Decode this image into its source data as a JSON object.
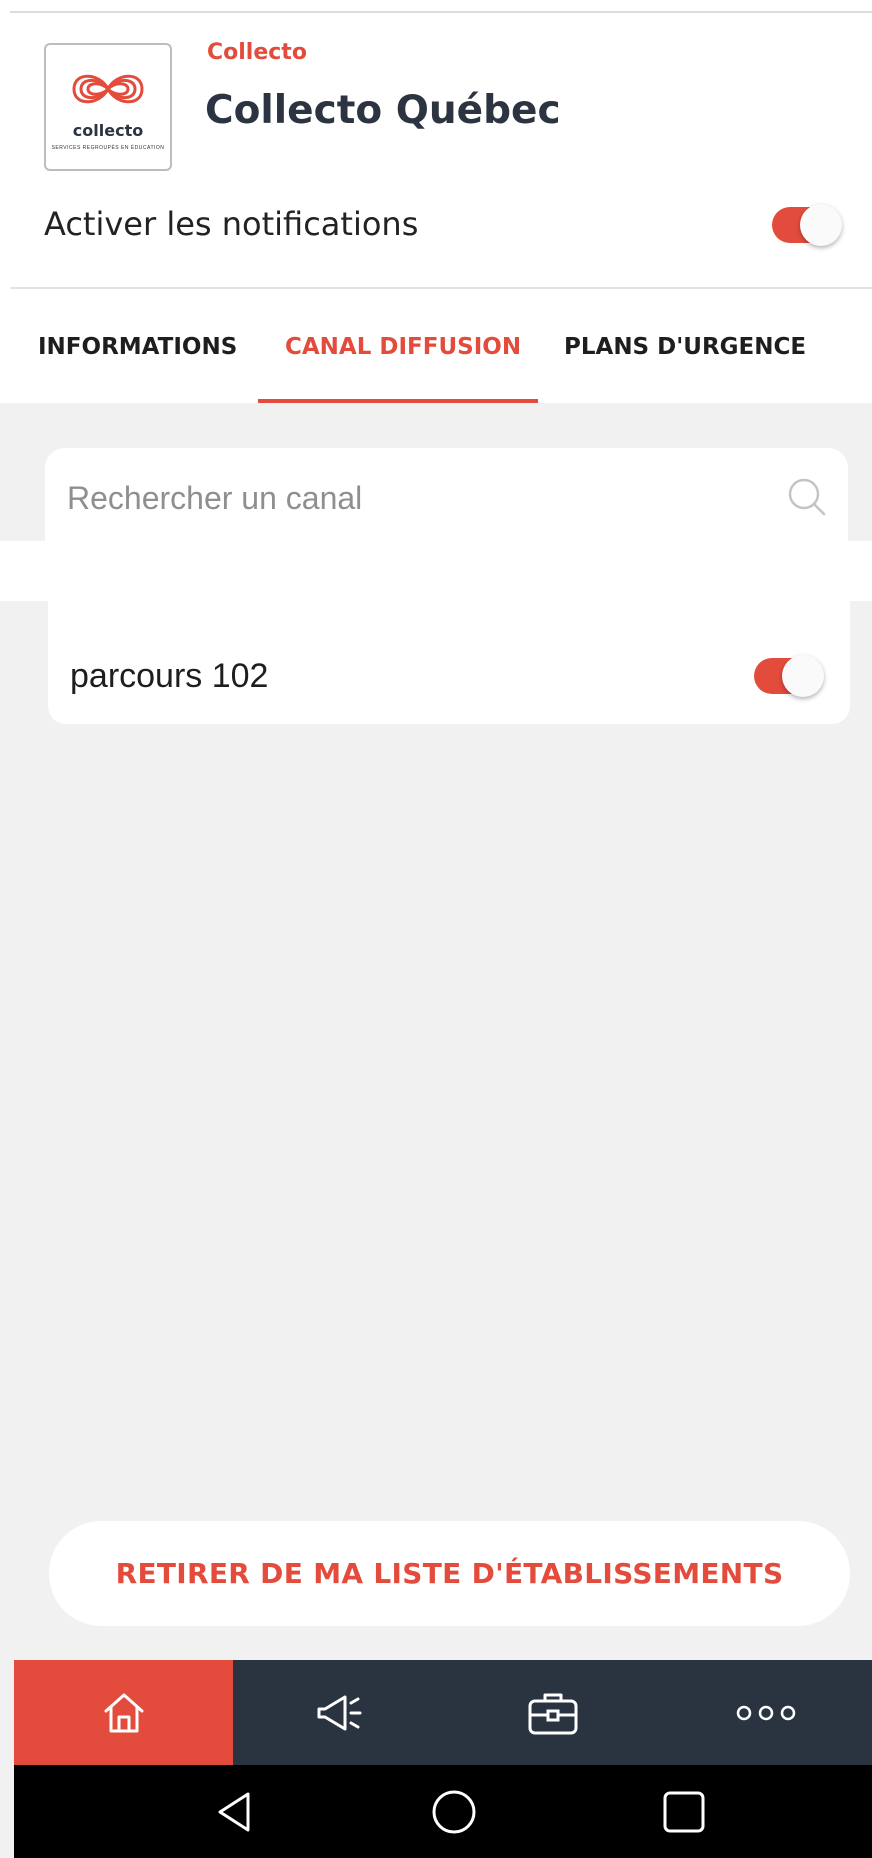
{
  "header": {
    "logo_word": "collecto",
    "logo_tagline": "SERVICES REGROUPÉS EN ÉDUCATION",
    "org_small": "Collecto",
    "org_title": "Collecto Québec"
  },
  "notifications": {
    "label": "Activer les notifications",
    "enabled": true
  },
  "tabs": [
    {
      "label": "INFORMATIONS",
      "active": false
    },
    {
      "label": "CANAL DIFFUSION",
      "active": true
    },
    {
      "label": "PLANS D'URGENCE",
      "active": false
    }
  ],
  "search": {
    "placeholder": "Rechercher un canal",
    "icon": "search-icon"
  },
  "channels": [
    {
      "label": "parcours 102",
      "enabled": true
    }
  ],
  "actions": {
    "remove_label": "RETIRER DE MA LISTE D'ÉTABLISSEMENTS"
  },
  "bottom_nav": [
    {
      "icon": "home-icon",
      "active": true
    },
    {
      "icon": "megaphone-icon",
      "active": false
    },
    {
      "icon": "briefcase-icon",
      "active": false
    },
    {
      "icon": "more-icon",
      "active": false
    }
  ],
  "system_nav": [
    "back-icon",
    "home-circle-icon",
    "recents-icon"
  ],
  "colors": {
    "accent": "#e34c3c",
    "dark": "#2a3440",
    "background": "#f1f1f1"
  }
}
